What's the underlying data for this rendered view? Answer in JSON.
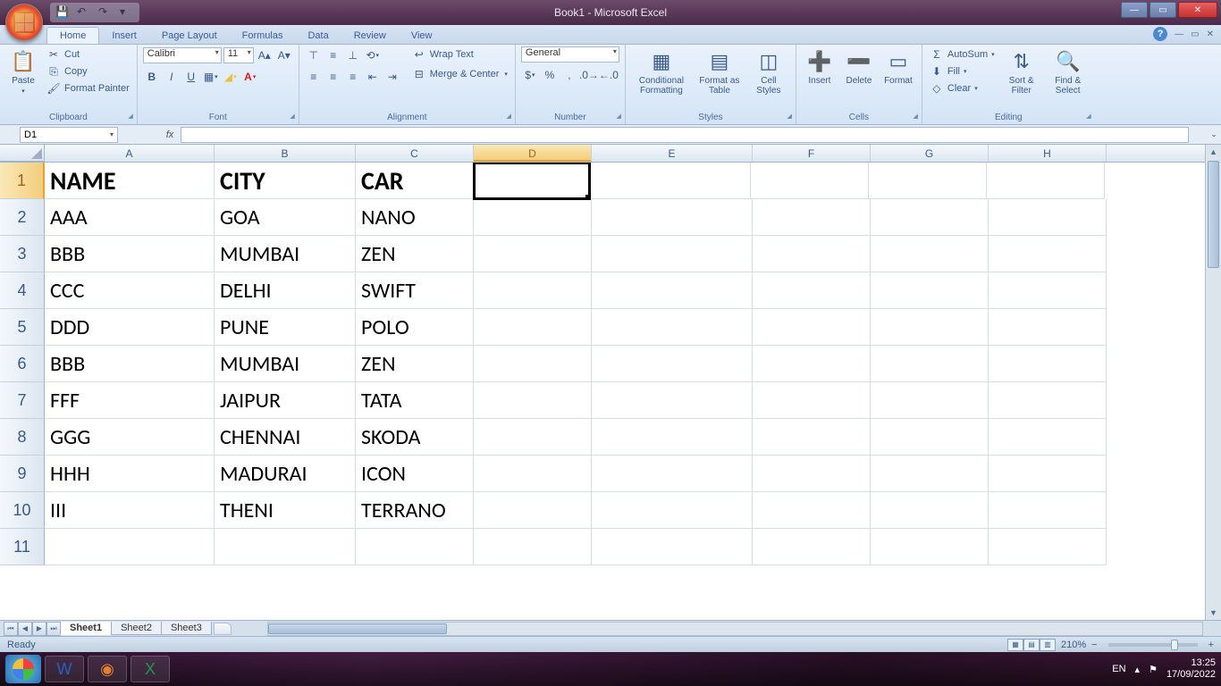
{
  "window": {
    "title": "Book1 - Microsoft Excel"
  },
  "qat": {
    "save": "💾",
    "undo": "↶",
    "redo": "↷"
  },
  "tabs": {
    "home": "Home",
    "insert": "Insert",
    "page_layout": "Page Layout",
    "formulas": "Formulas",
    "data": "Data",
    "review": "Review",
    "view": "View"
  },
  "ribbon": {
    "clipboard": {
      "paste": "Paste",
      "cut": "Cut",
      "copy": "Copy",
      "painter": "Format Painter",
      "label": "Clipboard"
    },
    "font": {
      "name": "Calibri",
      "size": "11",
      "label": "Font"
    },
    "alignment": {
      "wrap": "Wrap Text",
      "merge": "Merge & Center",
      "label": "Alignment"
    },
    "number": {
      "format": "General",
      "label": "Number"
    },
    "styles": {
      "cond": "Conditional Formatting",
      "table": "Format as Table",
      "cell": "Cell Styles",
      "label": "Styles"
    },
    "cells": {
      "insert": "Insert",
      "delete": "Delete",
      "format": "Format",
      "label": "Cells"
    },
    "editing": {
      "sum": "AutoSum",
      "fill": "Fill",
      "clear": "Clear",
      "sort": "Sort & Filter",
      "find": "Find & Select",
      "label": "Editing"
    }
  },
  "namebox": "D1",
  "columns": [
    "A",
    "B",
    "C",
    "D",
    "E",
    "F",
    "G",
    "H"
  ],
  "selected_col_idx": 3,
  "selected_row_idx": 0,
  "sheet": {
    "headers": [
      "NAME",
      "CITY",
      "CAR"
    ],
    "rows": [
      [
        "AAA",
        "GOA",
        "NANO"
      ],
      [
        "BBB",
        "MUMBAI",
        "ZEN"
      ],
      [
        "CCC",
        "DELHI",
        "SWIFT"
      ],
      [
        "DDD",
        "PUNE",
        "POLO"
      ],
      [
        "BBB",
        "MUMBAI",
        "ZEN"
      ],
      [
        "FFF",
        "JAIPUR",
        "TATA"
      ],
      [
        "GGG",
        "CHENNAI",
        "SKODA"
      ],
      [
        "HHH",
        "MADURAI",
        "ICON"
      ],
      [
        "III",
        "THENI",
        "TERRANO"
      ]
    ]
  },
  "sheets": {
    "s1": "Sheet1",
    "s2": "Sheet2",
    "s3": "Sheet3"
  },
  "status": {
    "ready": "Ready",
    "zoom": "210%",
    "lang": "EN"
  },
  "clock": {
    "time": "13:25",
    "date": "17/09/2022"
  }
}
